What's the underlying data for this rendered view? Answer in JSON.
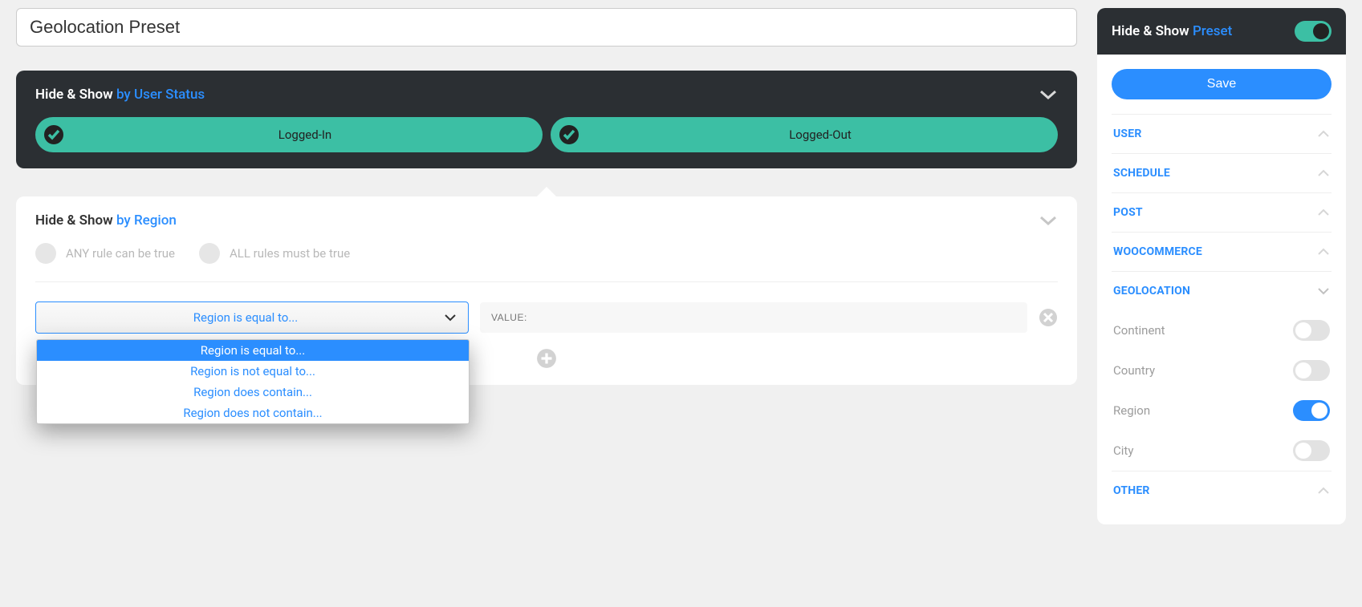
{
  "title": "Geolocation Preset",
  "panels": {
    "user_status": {
      "prefix": "Hide & Show",
      "suffix": "by User Status",
      "options": {
        "logged_in": "Logged-In",
        "logged_out": "Logged-Out"
      }
    },
    "region": {
      "prefix": "Hide & Show",
      "suffix": "by Region",
      "rule_mode": {
        "any": "ANY rule can be true",
        "all": "ALL rules must be true"
      },
      "select": {
        "value": "Region is equal to...",
        "options": [
          "Region is equal to...",
          "Region is not equal to...",
          "Region does contain...",
          "Region does not contain..."
        ]
      },
      "value_placeholder": "VALUE:"
    }
  },
  "sidebar": {
    "heading_prefix": "Hide & Show",
    "heading_suffix": "Preset",
    "save_label": "Save",
    "categories": {
      "user": "USER",
      "schedule": "SCHEDULE",
      "post": "POST",
      "woocommerce": "WOOCOMMERCE",
      "geolocation": "GEOLOCATION",
      "other": "OTHER"
    },
    "geo_items": {
      "continent": "Continent",
      "country": "Country",
      "region": "Region",
      "city": "City"
    }
  }
}
